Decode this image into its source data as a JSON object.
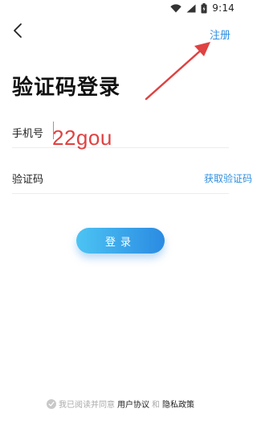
{
  "status_bar": {
    "time": "9:14",
    "icons": [
      "wifi-icon",
      "signal-icon",
      "battery-icon"
    ]
  },
  "header": {
    "back_icon": "chevron-left-icon",
    "register_label": "注册"
  },
  "title": "验证码登录",
  "form": {
    "phone_label": "手机号",
    "phone_value": "",
    "code_label": "验证码",
    "code_value": "",
    "get_code_label": "获取验证码"
  },
  "overlay_text": "22gou",
  "login_label": "登录",
  "agreement": {
    "prefix": "我已阅读并同意",
    "user_agreement": "用户协议",
    "conjunction": "和",
    "privacy_policy": "隐私政策"
  },
  "colors": {
    "accent": "#2f8fe0",
    "annotation": "#e04141",
    "button_start": "#4cc4f3",
    "button_end": "#2b8be2"
  }
}
